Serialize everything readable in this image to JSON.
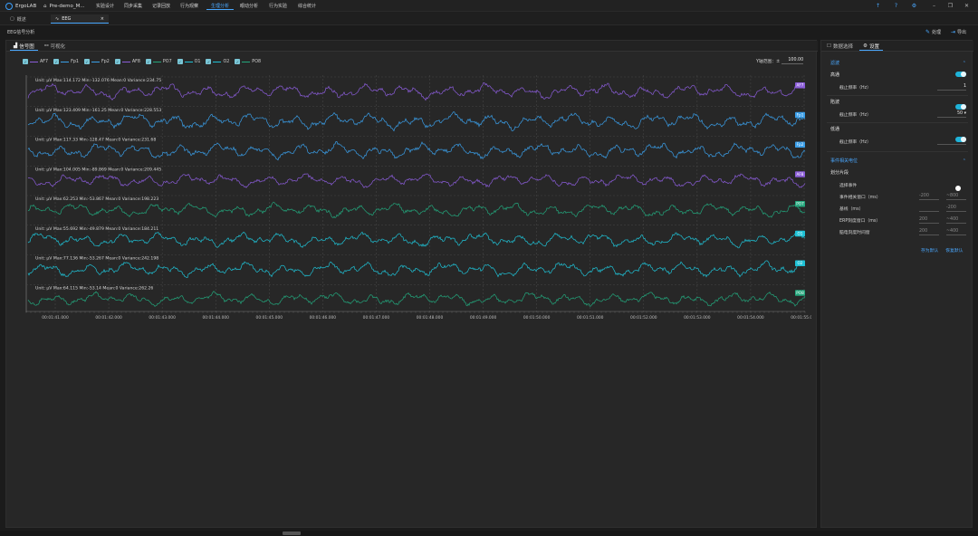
{
  "app": {
    "name": "ErgoLAB",
    "project_tab": "Pre-demo_M..."
  },
  "menu": [
    "实验设计",
    "同步采集",
    "记录回放",
    "行为观察",
    "生理分析",
    "眼动分析",
    "行为实验",
    "综合统计"
  ],
  "menu_active_index": 4,
  "doc_tabs": [
    {
      "label": "概述",
      "icon": "doc-icon"
    },
    {
      "label": "EEG",
      "icon": "wave-icon",
      "closable": true
    }
  ],
  "doc_tab_active_index": 1,
  "breadcrumb": "EEG信号分析",
  "header_buttons": {
    "process": "处理",
    "export": "导出"
  },
  "left_tabs": [
    "信号图",
    "可视化"
  ],
  "y_range": {
    "label": "Y轴范围：±",
    "value": "100.00"
  },
  "channels": [
    {
      "name": "AF7",
      "color": "#8a5cd8",
      "stats": "Unit: μV   Max:114.172   Min:-132.076   Mean:0   Variance:234.75",
      "amp": 0.9,
      "seed": 1
    },
    {
      "name": "Fp1",
      "color": "#3a9ee8",
      "stats": "Unit: μV   Max:123.409   Min:-161.25   Mean:0   Variance:228.553",
      "amp": 1.0,
      "seed": 2
    },
    {
      "name": "Fp2",
      "color": "#3a9ee8",
      "stats": "Unit: μV   Max:117.33   Min:-128.47   Mean:0   Variance:231.68",
      "amp": 0.95,
      "seed": 3
    },
    {
      "name": "AF8",
      "color": "#8a5cd8",
      "stats": "Unit: μV   Max:104.005   Min:-89.869   Mean:0   Variance:209.445",
      "amp": 0.8,
      "seed": 4
    },
    {
      "name": "PO7",
      "color": "#23a67c",
      "stats": "Unit: μV   Max:62.253   Min:-53.867   Mean:0   Variance:198.223",
      "amp": 0.85,
      "seed": 5
    },
    {
      "name": "O1",
      "color": "#1fc2d6",
      "stats": "Unit: μV   Max:55.692   Min:-49.879   Mean:0   Variance:184.211",
      "amp": 0.85,
      "seed": 6
    },
    {
      "name": "O2",
      "color": "#1fc2d6",
      "stats": "Unit: μV   Max:77.136   Min:-53.267   Mean:0   Variance:242.198",
      "amp": 0.9,
      "seed": 7
    },
    {
      "name": "PO8",
      "color": "#23a67c",
      "stats": "Unit: μV   Max:64.115   Min:-53.14   Mean:0   Variance:262.26",
      "amp": 0.8,
      "seed": 8
    }
  ],
  "x_ticks": [
    "00:01:41.000",
    "00:01:42.000",
    "00:01:43.000",
    "00:01:44.000",
    "00:01:45.000",
    "00:01:46.000",
    "00:01:47.000",
    "00:01:48.000",
    "00:01:49.000",
    "00:01:50.000",
    "00:01:51.000",
    "00:01:52.000",
    "00:01:53.000",
    "00:01:54.000",
    "00:01:55.000"
  ],
  "right_tabs": [
    "数据选择",
    "设置"
  ],
  "filter": {
    "title": "滤波",
    "highpass": {
      "label": "高通",
      "cutoff_label": "截止频率（Hz）",
      "value": "1"
    },
    "notch": {
      "label": "陷波",
      "cutoff_label": "截止频率（Hz）",
      "value": "50"
    },
    "lowpass": {
      "label": "低通",
      "cutoff_label": "截止频率（Hz）",
      "value": "70"
    }
  },
  "erp": {
    "title": "事件相关电位",
    "segment_label": "划分片段",
    "select_event": "选择事件",
    "event_window_label": "事件相关窗口（ms）",
    "event_window": [
      "-200",
      "~800"
    ],
    "baseline_label": "基线（ms）",
    "baseline": [
      "",
      "-200"
    ],
    "erp_window_label": "ERP刻度窗口（ms）",
    "erp_window": [
      "200",
      "~400"
    ],
    "segment_window_label": "脑电刻度时间窗",
    "segment_window": [
      "200",
      "~400"
    ],
    "save_default": "存为默认",
    "restore_default": "恢复默认"
  },
  "colors": {
    "accent": "#4aa8ff",
    "toggle": "#1fb3d9"
  }
}
